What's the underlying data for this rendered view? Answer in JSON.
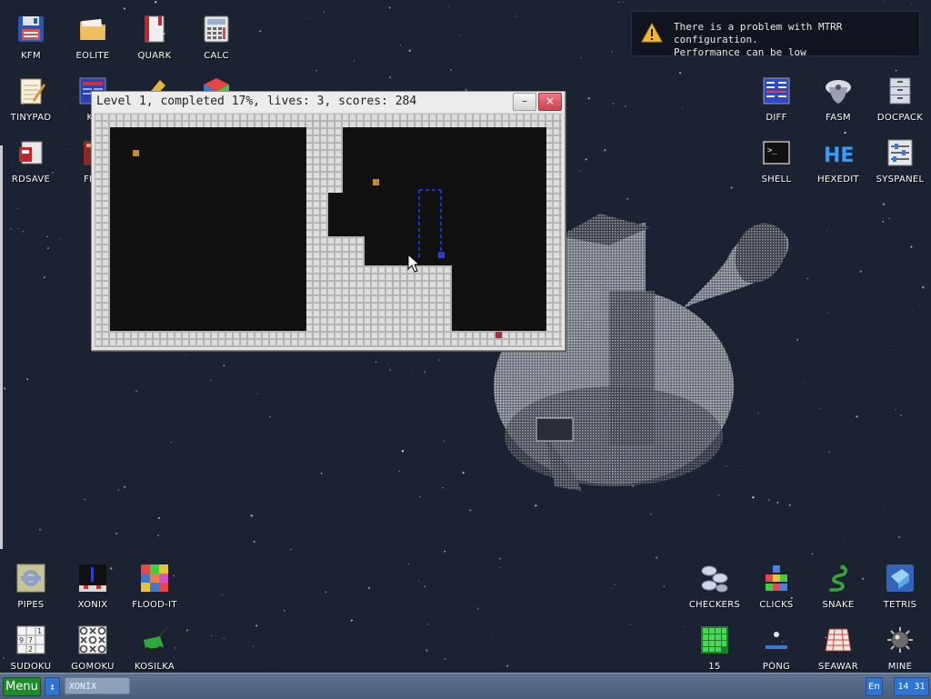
{
  "desktop": {
    "icons_left": [
      {
        "label": "KFM",
        "icon": "floppy-icon"
      },
      {
        "label": "EOLITE",
        "icon": "folder-icon"
      },
      {
        "label": "QUARK",
        "icon": "book-icon"
      },
      {
        "label": "CALC",
        "icon": "calculator-icon"
      },
      {
        "label": "TINYPAD",
        "icon": "notepad-icon"
      },
      {
        "label": "KF",
        "icon": "kfar-icon"
      },
      {
        "label": "RDSAVE",
        "icon": "rdsave-icon"
      },
      {
        "label": "FB2",
        "icon": "fb2-book-icon"
      }
    ],
    "icons_right": [
      {
        "label": "DIFF",
        "icon": "diff-icon"
      },
      {
        "label": "FASM",
        "icon": "fasm-icon"
      },
      {
        "label": "DOCPACK",
        "icon": "docpack-icon"
      },
      {
        "label": "SHELL",
        "icon": "shell-icon"
      },
      {
        "label": "HEXEDIT",
        "icon": "hexedit-icon"
      },
      {
        "label": "SYSPANEL",
        "icon": "syspanel-icon"
      }
    ],
    "games_left": [
      {
        "label": "PIPES",
        "icon": "pipes-icon"
      },
      {
        "label": "XONIX",
        "icon": "xonix-icon"
      },
      {
        "label": "FLOOD-IT",
        "icon": "flood-it-icon"
      },
      {
        "label": "SUDOKU",
        "icon": "sudoku-icon"
      },
      {
        "label": "GOMOKU",
        "icon": "gomoku-icon"
      },
      {
        "label": "KOSILKA",
        "icon": "lawnmower-icon"
      }
    ],
    "games_right": [
      {
        "label": "CHECKERS",
        "icon": "checkers-icon"
      },
      {
        "label": "CLICKS",
        "icon": "clicks-icon"
      },
      {
        "label": "SNAKE",
        "icon": "snake-icon"
      },
      {
        "label": "TETRIS",
        "icon": "tetris-icon"
      },
      {
        "label": "15",
        "icon": "fifteen-icon"
      },
      {
        "label": "PONG",
        "icon": "pong-icon"
      },
      {
        "label": "SEAWAR",
        "icon": "seawar-icon"
      },
      {
        "label": "MINE",
        "icon": "mine-icon"
      }
    ],
    "wallpaper": "treehouse-planet"
  },
  "notification": {
    "line1": "There is a problem with MTRR configuration.",
    "line2": "Performance can be low",
    "icon": "warning-icon"
  },
  "xonix_window": {
    "title": "Level 1, completed 17%, lives: 3, scores: 284",
    "minimize_label": "–",
    "close_label": "×",
    "level": 1,
    "completed_percent": 17,
    "lives": 3,
    "score": 284,
    "colors": {
      "filled": "#d9d9d9",
      "grid": "#b4b4b4",
      "empty": "#111111",
      "enemy": "#c8882a",
      "player": "#2e3fd0",
      "trail": "#1c35c8",
      "border_enemy": "#b8283a"
    }
  },
  "taskbar": {
    "menu_label": "Menu",
    "switch_label": "↕",
    "task_label": "XONIX",
    "language": "En",
    "clock": "14 31"
  }
}
